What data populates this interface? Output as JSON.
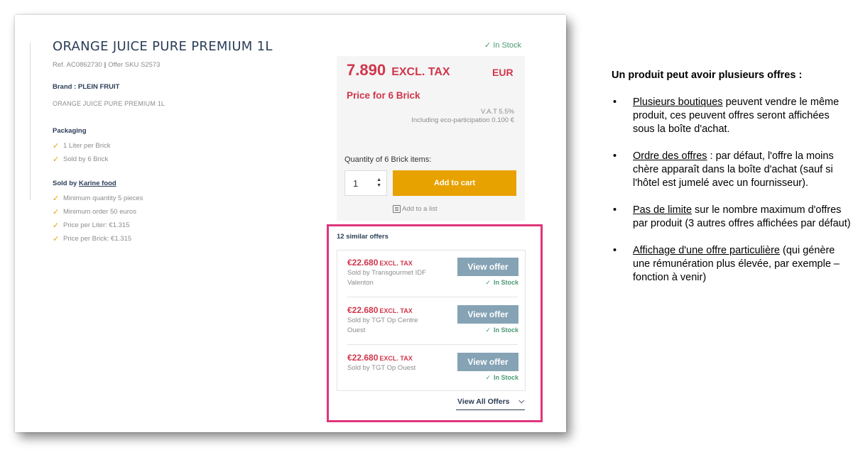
{
  "product": {
    "title": "ORANGE JUICE PURE PREMIUM 1L",
    "ref": "Ref. AC0862730",
    "sku": "Offer SKU S2573",
    "brand": "Brand : PLEIN FRUIT",
    "description": "ORANGE JUICE PURE PREMIUM 1L",
    "packaging_heading": "Packaging",
    "packaging": [
      "1 Liter per Brick",
      "Sold by 6 Brick"
    ],
    "sold_by_prefix": "Sold by",
    "sold_by_seller": "Karine food",
    "seller_conditions": [
      "Minimum quantity 5 pieces",
      "Minimum order 50 euros",
      "Price per Liter: €1.315",
      "Price per Brick: €1.315"
    ]
  },
  "buybox": {
    "stock": "In Stock",
    "price": "7.890",
    "price_unit": "EXCL. TAX",
    "currency": "EUR",
    "per_unit": "Price for 6 Brick",
    "vat": "V.A.T 5.5%",
    "eco": "Including eco-participation 0.100 €",
    "qty_label": "Quantity of 6 Brick items:",
    "qty_value": "1",
    "add_to_cart": "Add to cart",
    "add_to_list": "Add to a list"
  },
  "similar": {
    "title": "12 similar offers",
    "offers": [
      {
        "price": "€22.680",
        "unit": "EXCL. TAX",
        "seller": "Sold by Transgourmet IDF Valenton",
        "button": "View offer",
        "stock": "In Stock"
      },
      {
        "price": "€22.680",
        "unit": "EXCL. TAX",
        "seller": "Sold by TGT Op Centre Ouest",
        "button": "View offer",
        "stock": "In Stock"
      },
      {
        "price": "€22.680",
        "unit": "EXCL. TAX",
        "seller": "Sold by TGT Op Ouest",
        "button": "View offer",
        "stock": "In Stock"
      }
    ],
    "view_all": "View All Offers"
  },
  "notes": {
    "heading": "Un produit peut avoir plusieurs offres :",
    "items": [
      {
        "u": "Plusieurs boutiques",
        "rest": " peuvent  vendre le même produit, ces  peuvent offres seront affichées sous la boîte d'achat."
      },
      {
        "u": "Ordre des offres",
        "rest": " : par défaut,  l'offre la moins chère apparaît dans la boîte d'achat (sauf si l'hôtel est jumelé avec un fournisseur)."
      },
      {
        "u": "Pas de limite",
        "rest": " sur le nombre maximum d'offres par produit (3 autres offres affichées par défaut)"
      },
      {
        "u": "Affichage d'une offre particulière",
        "rest": " (qui génère une rémunération plus élevée, par exemple – fonction à venir)"
      }
    ]
  },
  "colors": {
    "price_red": "#d0364b",
    "cart_orange": "#e8a200",
    "offer_button": "#85a3b5",
    "highlight_pink": "#e0357a",
    "stock_green": "#4a9a73",
    "navy": "#2b3d57"
  },
  "icons": [
    "check-icon",
    "chevron-down-icon",
    "list-icon",
    "stepper-arrows-icon"
  ]
}
